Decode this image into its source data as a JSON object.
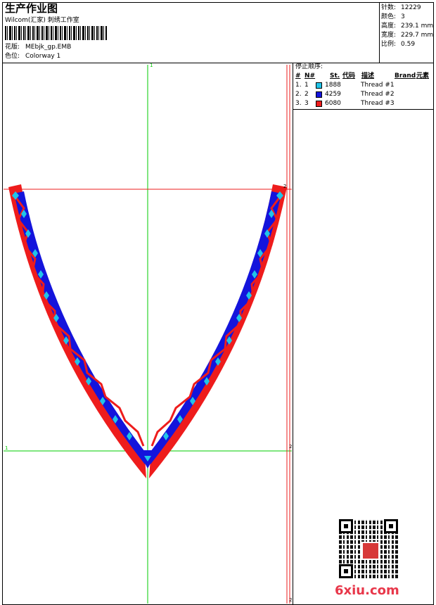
{
  "header": {
    "title": "生产作业图",
    "studio": "Wilcom(汇家) 刺绣工作室",
    "design_label": "花版:",
    "design_value": "MEbjk_gp.EMB",
    "colorway_label": "色位:",
    "colorway_value": "Colorway 1"
  },
  "stats": {
    "stitches_label": "针数:",
    "stitches_value": "12229",
    "colors_label": "颜色:",
    "colors_value": "3",
    "height_label": "高度:",
    "height_value": "239.1 mm",
    "width_label": "宽度:",
    "width_value": "229.7 mm",
    "scale_label": "比例:",
    "scale_value": "0.59"
  },
  "stop_sequence": {
    "title": "停止顺序:",
    "columns": {
      "no": "#",
      "needle": "N#",
      "st": "St.",
      "code": "代码",
      "desc": "描述",
      "brand": "Brand",
      "element": "元素"
    },
    "rows": [
      {
        "no": "1.",
        "needle": "1",
        "color": "#21c4e8",
        "code": "1888",
        "desc": "Thread #1"
      },
      {
        "no": "2.",
        "needle": "2",
        "color": "#1414dc",
        "code": "4259",
        "desc": "Thread #2"
      },
      {
        "no": "3.",
        "needle": "3",
        "color": "#ee1c1c",
        "code": "6080",
        "desc": "Thread #3"
      }
    ]
  },
  "guides": {
    "top_left": "1",
    "top_right": "2",
    "mid_left": "1",
    "right_mid": "2",
    "right_bottom": "2"
  },
  "watermark": {
    "text": "6xiu.com"
  },
  "colors": {
    "guide_green": "#00cc00",
    "guide_red": "#ee1c1c",
    "thread_1": "#21c4e8",
    "thread_2": "#1414dc",
    "thread_3": "#ee1c1c"
  }
}
